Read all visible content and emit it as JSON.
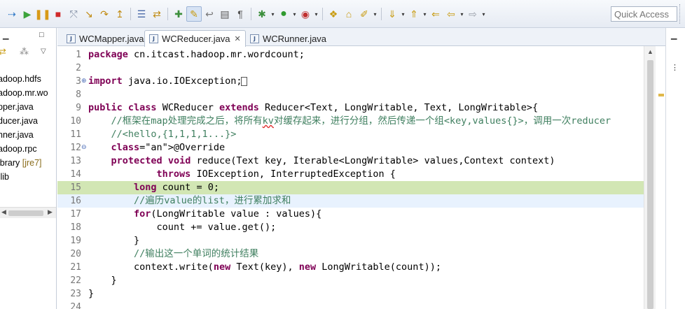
{
  "toolbar": {
    "quick_access_placeholder": "Quick Access",
    "buttons": [
      "skip-all-breakpoints",
      "resume",
      "suspend",
      "terminate",
      "disconnect",
      "step-into",
      "step-over",
      "step-return",
      "drop-to-frame",
      "use-step-filters",
      "new-java-package",
      "mark-occurrences",
      "toggle-word-wrap",
      "block-selection",
      "show-whitespace",
      "debug",
      "run",
      "coverage",
      "new-java-project",
      "open-type",
      "search",
      "next-annotation",
      "previous-annotation",
      "last-edit-location",
      "back",
      "forward"
    ]
  },
  "left_panel": {
    "items": [
      {
        "text": "adoop.hdfs",
        "suffix": ""
      },
      {
        "text": "adoop.mr.wo",
        "suffix": ""
      },
      {
        "text": "pper.java",
        "suffix": ""
      },
      {
        "text": "ducer.java",
        "suffix": ""
      },
      {
        "text": "nner.java",
        "suffix": ""
      },
      {
        "text": "adoop.rpc",
        "suffix": ""
      },
      {
        "text": "ibrary ",
        "suffix": "[jre7]"
      },
      {
        "text": ".lib",
        "suffix": ""
      }
    ]
  },
  "tabs": [
    {
      "label": "WCMapper.java",
      "active": false
    },
    {
      "label": "WCReducer.java",
      "active": true
    },
    {
      "label": "WCRunner.java",
      "active": false
    }
  ],
  "code_lines": [
    {
      "num": "1",
      "text": "package cn.itcast.hadoop.mr.wordcount;"
    },
    {
      "num": "2",
      "text": ""
    },
    {
      "num": "3",
      "text": "import java.io.IOException;"
    },
    {
      "num": "8",
      "text": ""
    },
    {
      "num": "9",
      "text": "public class WCReducer extends Reducer<Text, LongWritable, Text, LongWritable>{"
    },
    {
      "num": "10",
      "text": "    //框架在map处理完成之后，将所有kv对缓存起来，进行分组，然后传递一个组<key,values{}>，调用一次reducer"
    },
    {
      "num": "11",
      "text": "    //<hello,{1,1,1,1...}>"
    },
    {
      "num": "12",
      "text": "    @Override"
    },
    {
      "num": "13",
      "text": "    protected void reduce(Text key, Iterable<LongWritable> values,Context context)"
    },
    {
      "num": "14",
      "text": "            throws IOException, InterruptedException {"
    },
    {
      "num": "15",
      "text": "        long count = 0;"
    },
    {
      "num": "16",
      "text": "        //遍历value的list，进行累加求和"
    },
    {
      "num": "17",
      "text": "        for(LongWritable value : values){"
    },
    {
      "num": "18",
      "text": "            count += value.get();"
    },
    {
      "num": "19",
      "text": "        }"
    },
    {
      "num": "20",
      "text": "        //输出这一个单词的统计结果"
    },
    {
      "num": "21",
      "text": "        context.write(new Text(key), new LongWritable(count));"
    },
    {
      "num": "22",
      "text": "    }"
    },
    {
      "num": "23",
      "text": "}"
    },
    {
      "num": "24",
      "text": ""
    }
  ],
  "colors": {
    "keyword": "#7f0055",
    "comment": "#3f7f5f",
    "annotation": "#646464",
    "field": "#0000c0",
    "current_line": "#d2e6b4",
    "caret_line": "#e8f2fe"
  }
}
